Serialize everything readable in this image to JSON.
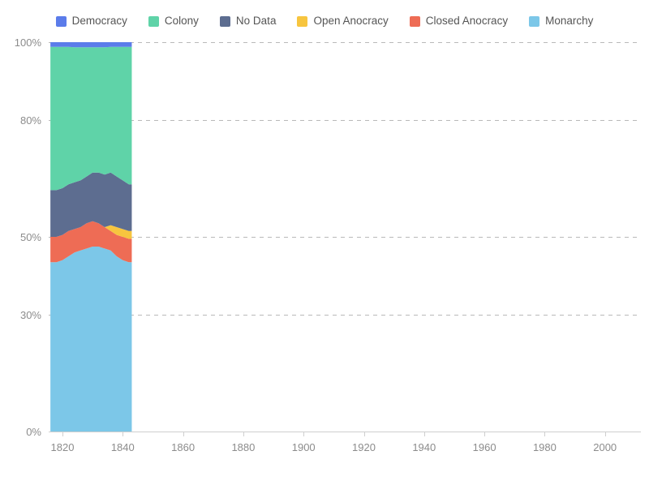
{
  "chart_data": {
    "type": "area",
    "title": "",
    "subtitle": "",
    "xlabel": "",
    "ylabel": "",
    "stacked": true,
    "normalized": true,
    "grid": true,
    "legend_position": "top",
    "xlim": [
      1816,
      2015
    ],
    "ylim": [
      0,
      100
    ],
    "x_ticks": [
      1820,
      1840,
      1860,
      1880,
      1900,
      1920,
      1940,
      1960,
      1980,
      2000
    ],
    "x_tick_labels": [
      "1820",
      "1840",
      "1860",
      "1880",
      "1900",
      "1920",
      "1940",
      "1960",
      "1980",
      "2000"
    ],
    "y_ticks": [
      0,
      30,
      50,
      80,
      100
    ],
    "y_tick_labels": [
      "0%",
      "30%",
      "50%",
      "80%",
      "100%"
    ],
    "x": [
      1816,
      1818,
      1820,
      1822,
      1824,
      1826,
      1828,
      1830,
      1832,
      1834,
      1836,
      1838,
      1840,
      1842,
      1843
    ],
    "series": [
      {
        "name": "Monarchy",
        "color": "#7cc7e8",
        "values": [
          43.5,
          43.5,
          44.0,
          45.0,
          46.0,
          46.5,
          47.0,
          47.5,
          47.5,
          47.0,
          46.5,
          45.0,
          44.0,
          43.5,
          43.5
        ]
      },
      {
        "name": "Closed Anocracy",
        "color": "#ee6c55",
        "values": [
          6.5,
          6.5,
          6.5,
          6.5,
          6.0,
          6.0,
          6.5,
          6.5,
          6.0,
          5.5,
          5.0,
          5.5,
          6.0,
          6.0,
          6.0
        ]
      },
      {
        "name": "Open Anocracy",
        "color": "#f7c53f",
        "values": [
          0.0,
          0.0,
          0.0,
          0.0,
          0.0,
          0.0,
          0.0,
          0.0,
          0.0,
          0.0,
          1.5,
          2.0,
          2.0,
          2.0,
          2.0
        ]
      },
      {
        "name": "No Data",
        "color": "#5d6d90",
        "values": [
          12.0,
          12.0,
          12.0,
          12.0,
          12.0,
          12.0,
          12.0,
          12.5,
          13.0,
          13.5,
          13.5,
          13.0,
          12.5,
          12.0,
          12.0
        ]
      },
      {
        "name": "Colony",
        "color": "#5fd3a8",
        "values": [
          36.8,
          36.8,
          36.3,
          35.3,
          34.7,
          34.2,
          33.2,
          32.2,
          32.2,
          32.7,
          32.3,
          33.3,
          34.3,
          35.3,
          35.3
        ]
      },
      {
        "name": "Democracy",
        "color": "#5b7cea",
        "values": [
          1.2,
          1.2,
          1.2,
          1.2,
          1.3,
          1.3,
          1.3,
          1.3,
          1.3,
          1.3,
          1.2,
          1.2,
          1.2,
          1.2,
          1.2
        ]
      }
    ]
  },
  "legend": {
    "items": [
      {
        "label": "Democracy",
        "color": "#5b7cea"
      },
      {
        "label": "Colony",
        "color": "#5fd3a8"
      },
      {
        "label": "No Data",
        "color": "#5d6d90"
      },
      {
        "label": "Open Anocracy",
        "color": "#f7c53f"
      },
      {
        "label": "Closed Anocracy",
        "color": "#ee6c55"
      },
      {
        "label": "Monarchy",
        "color": "#7cc7e8"
      }
    ]
  },
  "colors": {
    "background": "#ffffff",
    "gridline": "#b9b9b9",
    "axis": "#cfcfcf",
    "tick_text": "#8c8c8c",
    "legend_text": "#555555"
  }
}
